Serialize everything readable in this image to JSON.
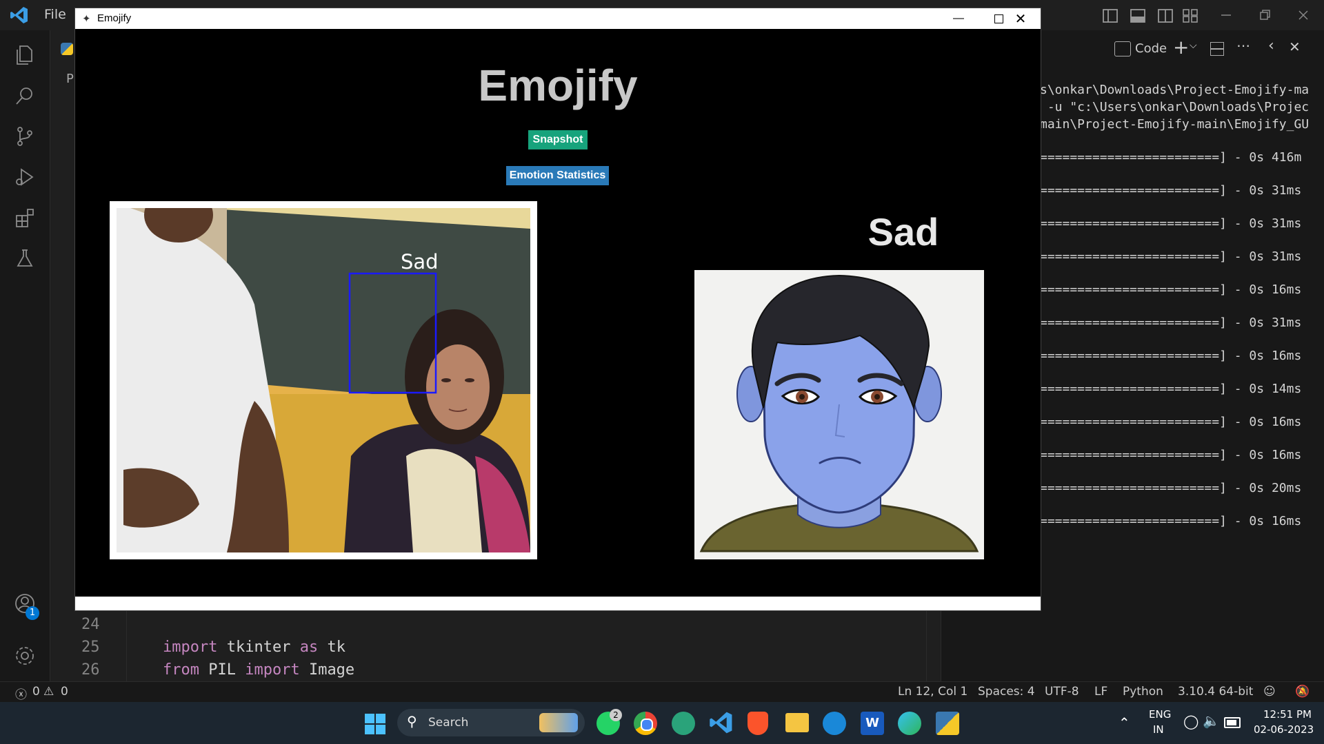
{
  "vscode": {
    "menu_file": "File",
    "explorer_tab_letter": "P",
    "accounts_badge": "1",
    "terminal_header": {
      "profile": "Code"
    },
    "terminal_lines": [
      "s\\onkar\\Downloads\\Project-Emojify-ma",
      " -u \"c:\\Users\\onkar\\Downloads\\Projec",
      "main\\Project-Emojify-main\\Emojify_GU"
    ],
    "progress_lines": [
      "========================] - 0s 416m",
      "========================] - 0s 31ms",
      "========================] - 0s 31ms",
      "========================] - 0s 31ms",
      "========================] - 0s 16ms",
      "========================] - 0s 31ms",
      "========================] - 0s 16ms",
      "========================] - 0s 14ms",
      "========================] - 0s 16ms",
      "========================] - 0s 16ms",
      "========================] - 0s 20ms",
      "========================] - 0s 16ms"
    ],
    "code": [
      {
        "num": "24",
        "text": ""
      },
      {
        "num": "25",
        "kw1": "import",
        "mid": " tkinter ",
        "kw2": "as",
        "tail": " tk"
      },
      {
        "num": "26",
        "kw1": "from",
        "mid": " PIL ",
        "kw2": "import",
        "tail": " Image"
      }
    ],
    "status": {
      "errors": "0",
      "warnings": "0",
      "position": "Ln 12, Col 1",
      "spaces": "Spaces: 4",
      "encoding": "UTF-8",
      "eol": "LF",
      "language": "Python",
      "interpreter": "3.10.4 64-bit"
    }
  },
  "emojify_window": {
    "title": "Emojify",
    "heading": "Emojify",
    "snapshot_button": "Snapshot",
    "stats_button": "Emotion Statistics",
    "face_label": "Sad",
    "emotion_label": "Sad",
    "colors": {
      "snapshot": "#17a37c",
      "stats": "#2a7ab8",
      "facebox": "#1a1aff"
    }
  },
  "taskbar": {
    "search": "Search",
    "whatsapp_badge": "2",
    "lang_top": "ENG",
    "lang_bottom": "IN",
    "time": "12:51 PM",
    "date": "02-06-2023"
  }
}
